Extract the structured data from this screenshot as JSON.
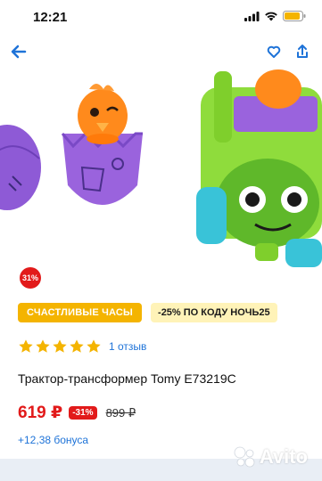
{
  "status_bar": {
    "time": "12:21"
  },
  "product": {
    "discount_chip": "31%",
    "promo_happy_hours": "СЧАСТЛИВЫЕ ЧАСЫ",
    "promo_code": "-25% ПО КОДУ НОЧЬ25",
    "rating": {
      "stars": 5,
      "reviews_label": "1 отзыв"
    },
    "title": "Трактор-трансформер Tomy E73219C",
    "price_current": "619 ₽",
    "price_discount": "-31%",
    "price_old": "899 ₽",
    "bonus": "+12,38 бонуса"
  },
  "watermark": {
    "brand": "Avito"
  },
  "colors": {
    "accent_blue": "#1e73d8",
    "sale_red": "#e21a1a",
    "promo_yellow": "#f4b400",
    "promo_light": "#fff3b8",
    "star_yellow": "#f4b400"
  },
  "icons": {
    "back": "arrow-left-icon",
    "favorite": "heart-icon",
    "share": "share-icon"
  }
}
